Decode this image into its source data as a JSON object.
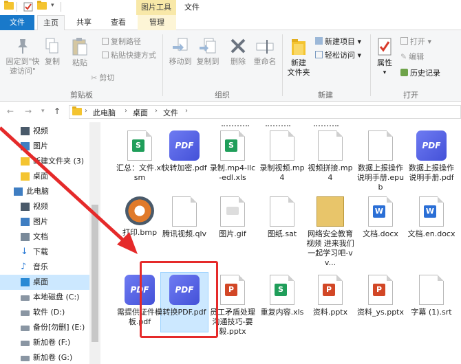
{
  "titlebar": {
    "contextual_tab": "图片工具",
    "title": "文件"
  },
  "tabs": [
    "文件",
    "主页",
    "共享",
    "查看",
    "管理"
  ],
  "ribbon": {
    "clipboard": {
      "pin": "固定到\"快速访问\"",
      "copy": "复制",
      "paste": "粘贴",
      "copy_path": "复制路径",
      "paste_shortcut": "粘贴快捷方式",
      "cut": "剪切",
      "label": "剪贴板"
    },
    "organize": {
      "move_to": "移动到",
      "copy_to": "复制到",
      "delete": "删除",
      "rename": "重命名",
      "label": "组织"
    },
    "new": {
      "new_folder": "新建\n文件夹",
      "new_item": "新建项目",
      "easy_access": "轻松访问",
      "label": "新建"
    },
    "open": {
      "properties": "属性",
      "open": "打开",
      "edit": "编辑",
      "history": "历史记录",
      "label": "打开"
    }
  },
  "address": {
    "crumbs": [
      "此电脑",
      "桌面",
      "文件"
    ]
  },
  "nav": [
    {
      "label": "视频",
      "icon": "video-icon",
      "selected": false
    },
    {
      "label": "图片",
      "icon": "pictures-icon",
      "selected": false
    },
    {
      "label": "新建文件夹 (3)",
      "icon": "folder-icon",
      "selected": false
    },
    {
      "label": "桌面",
      "icon": "folder-icon",
      "selected": false
    },
    {
      "label": "此电脑",
      "icon": "computer-icon",
      "selected": false
    },
    {
      "label": "视频",
      "icon": "video-icon",
      "selected": false
    },
    {
      "label": "图片",
      "icon": "pictures-icon",
      "selected": false
    },
    {
      "label": "文档",
      "icon": "documents-icon",
      "selected": false
    },
    {
      "label": "下载",
      "icon": "download-icon",
      "selected": false
    },
    {
      "label": "音乐",
      "icon": "music-icon",
      "selected": false
    },
    {
      "label": "桌面",
      "icon": "desktop-icon",
      "selected": true
    },
    {
      "label": "本地磁盘 (C:)",
      "icon": "drive-icon",
      "selected": false
    },
    {
      "label": "软件 (D:)",
      "icon": "drive-icon",
      "selected": false
    },
    {
      "label": "备份[勿删] (E:)",
      "icon": "drive-icon",
      "selected": false
    },
    {
      "label": "新加卷 (F:)",
      "icon": "drive-icon",
      "selected": false
    },
    {
      "label": "新加卷 (G:)",
      "icon": "drive-icon",
      "selected": false
    }
  ],
  "files": [
    {
      "name": "汇总：文件.xlsm",
      "type": "xls"
    },
    {
      "name": "快转加密.pdf",
      "type": "pdf"
    },
    {
      "name": "录制.mp4-llc-edl.xls",
      "type": "xls"
    },
    {
      "name": "录制视频.mp4",
      "type": "doc"
    },
    {
      "name": "视频拼接.mp4",
      "type": "doc"
    },
    {
      "name": "数据上报操作说明手册.epub",
      "type": "doc"
    },
    {
      "name": "数据上报操作说明手册.pdf",
      "type": "pdf"
    },
    {
      "name": "打印.bmp",
      "type": "bmp"
    },
    {
      "name": "腾讯视频.qlv",
      "type": "doc"
    },
    {
      "name": "图片.gif",
      "type": "gif"
    },
    {
      "name": "图纸.sat",
      "type": "doc"
    },
    {
      "name": "网络安全教育视频 进来我们一起学习吧-vv...",
      "type": "thumb"
    },
    {
      "name": "文档.docx",
      "type": "docx"
    },
    {
      "name": "文档.en.docx",
      "type": "docx"
    },
    {
      "name": "需提供证件模板.pdf",
      "type": "pdf"
    },
    {
      "name": "转换PDF.pdf",
      "type": "pdf"
    },
    {
      "name": "员工矛盾处理沟通技巧-要毅.pptx",
      "type": "ppt"
    },
    {
      "name": "重复内容.xls",
      "type": "xls"
    },
    {
      "name": "资料.pptx",
      "type": "ppt"
    },
    {
      "name": "资料_ys.pptx",
      "type": "ppt"
    },
    {
      "name": "字幕 (1).srt",
      "type": "doc"
    }
  ],
  "pdf_icon_text": "PDF",
  "colors": {
    "accent": "#1979ca",
    "selection": "#cce8ff",
    "annotation": "#e52a2a"
  }
}
